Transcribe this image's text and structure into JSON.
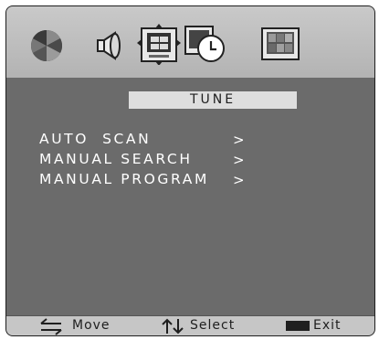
{
  "icons": {
    "picture": "picture-icon",
    "sound": "sound-icon",
    "channel": "channel-icon",
    "time": "clock-icon",
    "setup": "setup-icon"
  },
  "menu": {
    "title": "TUNE",
    "items": [
      {
        "label": "AUTO  SCAN",
        "arrow": ">"
      },
      {
        "label": "MANUAL SEARCH",
        "arrow": ">"
      },
      {
        "label": "MANUAL PROGRAM",
        "arrow": ">"
      }
    ]
  },
  "footer": {
    "move_label": "Move",
    "select_label": "Select",
    "exit_label": "Exit"
  },
  "colors": {
    "panel": "#6b6b6b",
    "top_bar": "#c0c0c0",
    "text": "#ffffff"
  }
}
